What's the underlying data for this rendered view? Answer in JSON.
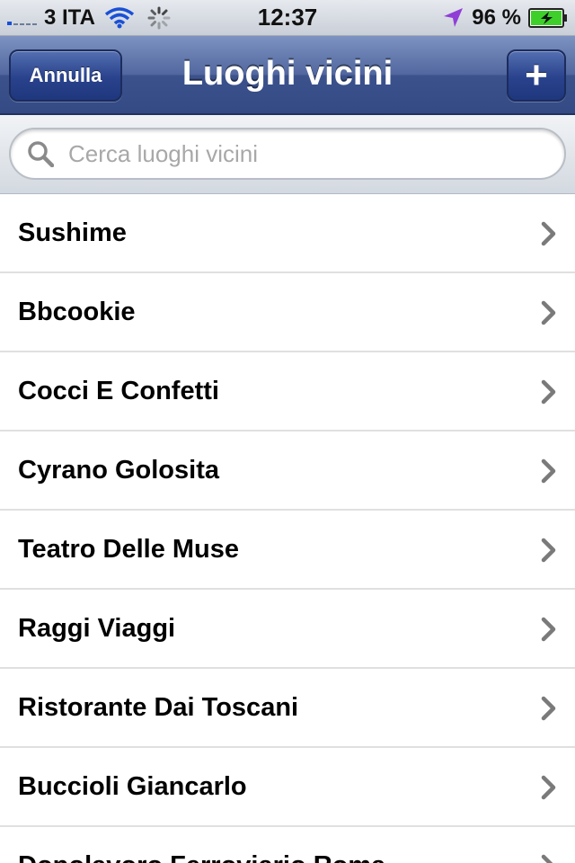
{
  "status_bar": {
    "carrier": "3 ITA",
    "time": "12:37",
    "battery_percent": "96 %",
    "icons": [
      "signal-icon",
      "wifi-icon",
      "activity-icon",
      "location-icon",
      "battery-charging-icon"
    ]
  },
  "nav_bar": {
    "title": "Luoghi vicini",
    "cancel_label": "Annulla",
    "add_label": "+"
  },
  "search": {
    "placeholder": "Cerca luoghi vicini",
    "value": ""
  },
  "places": [
    {
      "name": "Sushime"
    },
    {
      "name": "Bbcookie"
    },
    {
      "name": "Cocci E Confetti"
    },
    {
      "name": "Cyrano Golosita"
    },
    {
      "name": "Teatro Delle Muse"
    },
    {
      "name": "Raggi Viaggi"
    },
    {
      "name": "Ristorante Dai Toscani"
    },
    {
      "name": "Buccioli Giancarlo"
    },
    {
      "name": "Dopolavoro Ferroviario Roma"
    }
  ],
  "colors": {
    "nav_bar": "#3c528c",
    "nav_button": "#29428c",
    "location_arrow": "#8f3fd6",
    "battery_fill": "#3fcf2a"
  }
}
